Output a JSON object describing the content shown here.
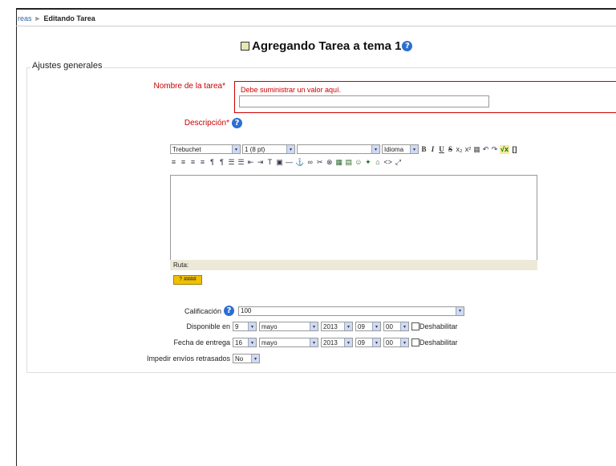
{
  "breadcrumb": {
    "prev": "reas",
    "separator": "►",
    "current": "Editando Tarea"
  },
  "page": {
    "title": "Agregando Tarea a tema 1",
    "help_icon": "?"
  },
  "fieldset": {
    "legend": "Ajustes generales"
  },
  "name": {
    "label": "Nombre de la tarea",
    "required": "*",
    "error": "Debe suministrar un valor aquí.",
    "value": ""
  },
  "description": {
    "label": "Descripción",
    "required": "*"
  },
  "editor": {
    "font": "Trebuchet",
    "size": "1 (8 pt)",
    "style": "",
    "lang": "Idioma",
    "bold": "B",
    "italic": "I",
    "underline": "U",
    "strike": "S",
    "sub": "x₂",
    "sup": "x²",
    "undo": "↶",
    "redo": "↷",
    "spell": "√x",
    "brackets": "[]",
    "row2": [
      "≡",
      "≡",
      "≡",
      "≡",
      "¶",
      "¶",
      "☰",
      "☰",
      "⇤",
      "⇥",
      "T",
      "▣",
      "—",
      "⚓",
      "∞",
      "✂",
      "⊗",
      "▦",
      "▤",
      "☺",
      "✦",
      "⌂",
      "<>",
      "⤢"
    ],
    "path_label": "Ruta:",
    "help_btn": "? ####"
  },
  "grade": {
    "label": "Calificación",
    "value": "100"
  },
  "available": {
    "label": "Disponible en",
    "day": "9",
    "month": "mayo",
    "year": "2013",
    "hour": "09",
    "minute": "00",
    "disable": "Deshabilitar"
  },
  "due": {
    "label": "Fecha de entrega",
    "day": "16",
    "month": "mayo",
    "year": "2013",
    "hour": "09",
    "minute": "00",
    "disable": "Deshabilitar"
  },
  "prevent_late": {
    "label": "Impedir envíos retrasados",
    "value": "No"
  },
  "icons": {
    "dropdown": "▾"
  }
}
